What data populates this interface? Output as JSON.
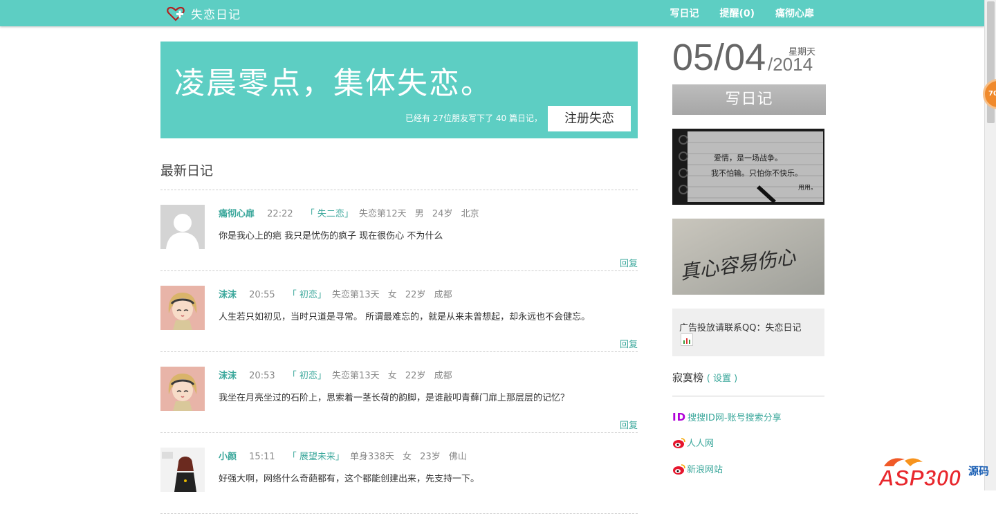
{
  "header": {
    "site_name": "失恋日记",
    "nav": [
      "写日记",
      "提醒(0)",
      "痛彻心扉"
    ]
  },
  "hero": {
    "slogan": "凌晨零点，集体失恋。",
    "stats": "已经有 27位朋友写下了 40 篇日记，",
    "register_label": "注册失恋"
  },
  "main": {
    "section_title": "最新日记",
    "reply_label": "回复",
    "entries": [
      {
        "author": "痛彻心扉",
        "time": "22:22",
        "category": "「 失二恋」",
        "status": "失恋第12天",
        "gender": "男",
        "age": "24岁",
        "city": "北京",
        "content": "你是我心上的疤 我只是忧伤的疯子 现在很伤心 不为什么",
        "avatar": "default-avatar"
      },
      {
        "author": "沫沫",
        "time": "20:55",
        "category": "「 初恋」",
        "status": "失恋第13天",
        "gender": "女",
        "age": "22岁",
        "city": "成都",
        "content": "人生若只如初见，当时只道是寻常。 所谓最难忘的，就是从来未曾想起，却永远也不会健忘。",
        "avatar": "anime-girl-avatar"
      },
      {
        "author": "沫沫",
        "time": "20:53",
        "category": "「 初恋」",
        "status": "失恋第13天",
        "gender": "女",
        "age": "22岁",
        "city": "成都",
        "content": "我坐在月亮坐过的石阶上，思索着一茎长荷的韵脚，是谁敲叩青藓门扉上那层层的记忆？",
        "avatar": "anime-girl-avatar"
      },
      {
        "author": "小颜",
        "time": "15:11",
        "category": "「 展望未来」",
        "status": "单身338天",
        "gender": "女",
        "age": "23岁",
        "city": "佛山",
        "content": "好强大啊，网络什么奇葩都有，这个都能创建出来，先支持一下。",
        "avatar": "photo-avatar"
      }
    ]
  },
  "sidebar": {
    "date": "05/04",
    "year": "/2014",
    "weekday": "星期天",
    "write_label": "写日记",
    "image1_lines": [
      "爱情，是一场战争。",
      "我不怕输。只怕你不快乐。",
      "用用。"
    ],
    "image2_text": "真心容易伤心",
    "ad_text": "广告投放请联系QQ：失恋日记",
    "rank_title": "寂寞榜",
    "rank_settings": "( 设置 )",
    "links": [
      {
        "icon": "id-icon",
        "icon_text": "ID",
        "label": "搜搜ID网-账号搜索分享"
      },
      {
        "icon": "weibo-icon",
        "label": "人人网"
      },
      {
        "icon": "weibo-icon",
        "label": "新浪网站"
      }
    ]
  },
  "float_badge": "70",
  "watermark": {
    "brand": "ASP300",
    "suffix": "源码"
  },
  "colors": {
    "accent": "#5dcec3",
    "link": "#3aa79b"
  }
}
